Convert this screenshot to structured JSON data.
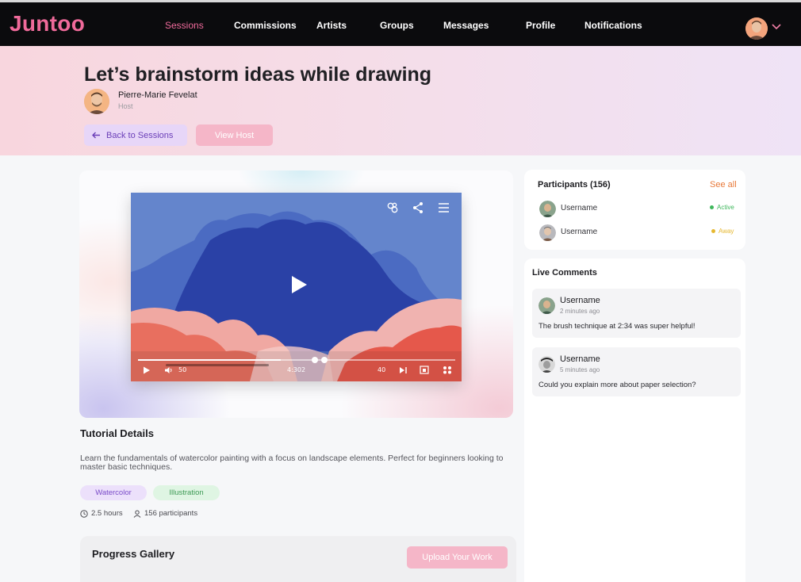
{
  "app": {
    "logo": "Juntoo"
  },
  "nav": {
    "items": [
      {
        "label": "Sessions",
        "active": true
      },
      {
        "label": "Commissions",
        "active": false
      },
      {
        "label": "Artists",
        "active": false
      },
      {
        "label": "Groups",
        "active": false
      },
      {
        "label": "Messages",
        "active": false
      },
      {
        "label": "Profile",
        "active": false
      },
      {
        "label": "Notifications",
        "active": false
      }
    ],
    "avatar_icon": "user-avatar-icon",
    "dropdown_icon": "chevron-down-icon"
  },
  "session": {
    "title": "Let’s brainstorm ideas while drawing",
    "host_name": "Pierre-Marie Fevelat",
    "host_role": "Host",
    "back_label": "Back to Sessions",
    "view_host_label": "View Host"
  },
  "player": {
    "volume": "50",
    "time": "4:302",
    "speed": "40",
    "progress_fraction": 0.45,
    "icons": [
      "link-icon",
      "share-icon",
      "menu-icon",
      "play-icon",
      "volume-icon",
      "next-icon",
      "captions-icon",
      "fullscreen-icon"
    ]
  },
  "tutorial": {
    "heading": "Tutorial Details",
    "description": "Learn the fundamentals of watercolor painting with a focus on landscape elements. Perfect for beginners looking to master basic techniques.",
    "tags": [
      "Watercolor",
      "Illustration"
    ],
    "duration": "2.5 hours",
    "participants": "156 participants"
  },
  "gallery": {
    "heading": "Progress Gallery",
    "upload_label": "Upload Your Work"
  },
  "participants": {
    "heading": "Participants (156)",
    "see_all": "See all",
    "list": [
      {
        "name": "Username",
        "status": "Active"
      },
      {
        "name": "Username",
        "status": "Away"
      }
    ]
  },
  "comments": {
    "heading": "Live Comments",
    "list": [
      {
        "user": "Username",
        "time": "2 minutes ago",
        "text": "The brush technique at 2:34 was super helpful!"
      },
      {
        "user": "Username",
        "time": "5 minutes ago",
        "text": "Could you explain more about paper selection?"
      }
    ]
  },
  "colors": {
    "brand": "#ef6a9a",
    "active_status": "#3fb75c",
    "away_status": "#e6b830",
    "see_all": "#e8793a"
  }
}
